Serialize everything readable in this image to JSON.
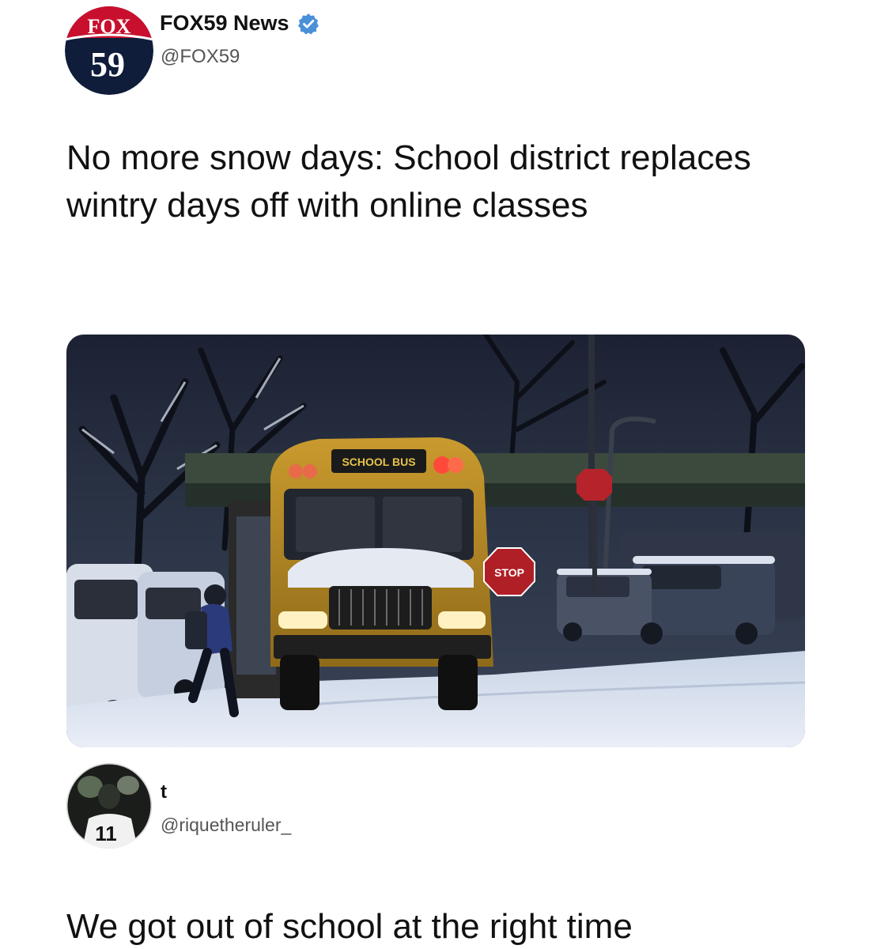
{
  "tweet": {
    "avatar": {
      "logo_text_top": "FOX",
      "logo_text_bottom": "59",
      "icon": "fox59-logo-icon"
    },
    "display_name": "FOX59 News",
    "verified_icon": "verified-badge-icon",
    "handle": "@FOX59",
    "text": "No more snow days: School district replaces wintry days off with online classes",
    "media": {
      "icon": "school-bus-snow-photo",
      "bus_sign": "SCHOOL BUS",
      "stop_sign": "STOP"
    }
  },
  "reply": {
    "avatar_icon": "football-player-avatar-icon",
    "display_name": "t",
    "handle": "@riquetheruler_",
    "text": "We got out of school at the right time"
  },
  "colors": {
    "fox_red": "#c8102e",
    "fox_navy": "#0f1d3b",
    "verified_blue": "#4a90d9",
    "text": "#111111",
    "muted": "#555555"
  }
}
